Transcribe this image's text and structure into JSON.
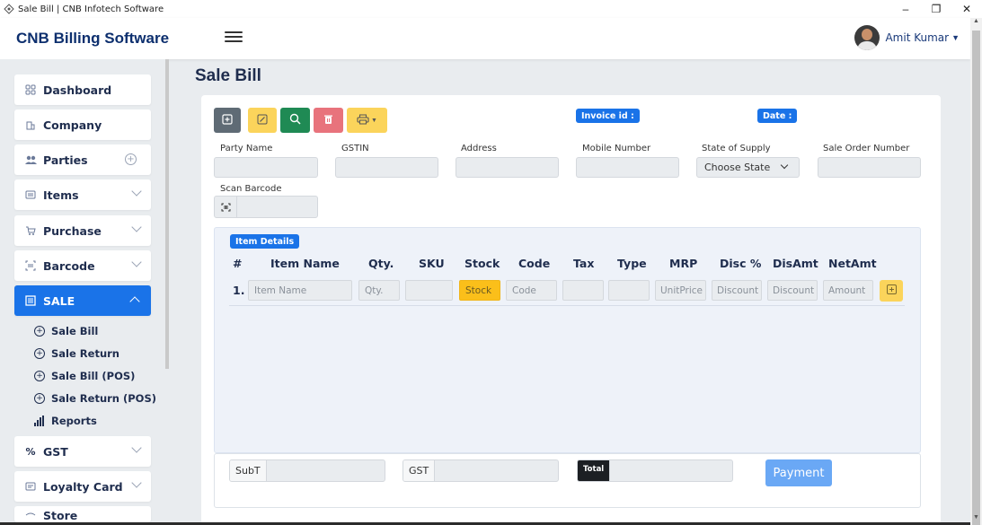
{
  "window": {
    "title": "Sale Bill | CNB Infotech Software",
    "minimize": "–",
    "maximize": "❐",
    "close": "✕"
  },
  "header": {
    "brand_prefix": "CNB",
    "brand_rest": "Billing Software",
    "user_name": "Amit Kumar"
  },
  "sidebar": {
    "items": [
      {
        "label": "Dashboard",
        "icon": "grid-icon"
      },
      {
        "label": "Company",
        "icon": "building-icon"
      },
      {
        "label": "Parties",
        "icon": "users-icon"
      },
      {
        "label": "Items",
        "icon": "list-icon"
      },
      {
        "label": "Purchase",
        "icon": "cart-icon"
      },
      {
        "label": "Barcode",
        "icon": "barcode-icon"
      },
      {
        "label": "SALE",
        "icon": "receipt-icon"
      },
      {
        "label": "GST",
        "icon": "percent-icon"
      },
      {
        "label": "Loyalty Card",
        "icon": "card-icon"
      },
      {
        "label": "Store",
        "icon": "store-icon"
      }
    ],
    "sale_sub": [
      {
        "label": "Sale Bill"
      },
      {
        "label": "Sale Return"
      },
      {
        "label": "Sale Bill (POS)"
      },
      {
        "label": "Sale Return (POS)"
      },
      {
        "label": "Reports"
      }
    ]
  },
  "main": {
    "page_title": "Sale Bill",
    "invoice_badge": "Invoice id :",
    "date_badge": "Date :",
    "fields": {
      "party_name": "Party Name",
      "gstin": "GSTIN",
      "address": "Address",
      "mobile": "Mobile Number",
      "state": "State of Supply",
      "state_value": "Choose State",
      "sale_order": "Sale Order Number",
      "scan_barcode": "Scan Barcode"
    },
    "item_details_badge": "Item Details",
    "columns": [
      "#",
      "Item Name",
      "Qty.",
      "SKU",
      "Stock",
      "Code",
      "Tax",
      "Type",
      "MRP",
      "Disc %",
      "DisAmt",
      "NetAmt"
    ],
    "row": {
      "index": "1.",
      "item_name": "Item Name",
      "qty": "Qty.",
      "sku": "",
      "stock": "Stock",
      "code": "Code",
      "tax": "",
      "type": "",
      "mrp": "UnitPrice",
      "disc_pct": "Discount",
      "disamt": "Discount",
      "netamt": "Amount"
    },
    "footer": {
      "subtotal": "SubT",
      "gst": "GST",
      "total": "Total",
      "payment": "Payment"
    }
  },
  "colors": {
    "primary": "#1a73e8",
    "brand": "#0d2f6e",
    "yellow": "#fbd45b",
    "green": "#1f8a54",
    "red": "#e8737c",
    "gray": "#5f6b75",
    "stock": "#fbbf1a"
  }
}
